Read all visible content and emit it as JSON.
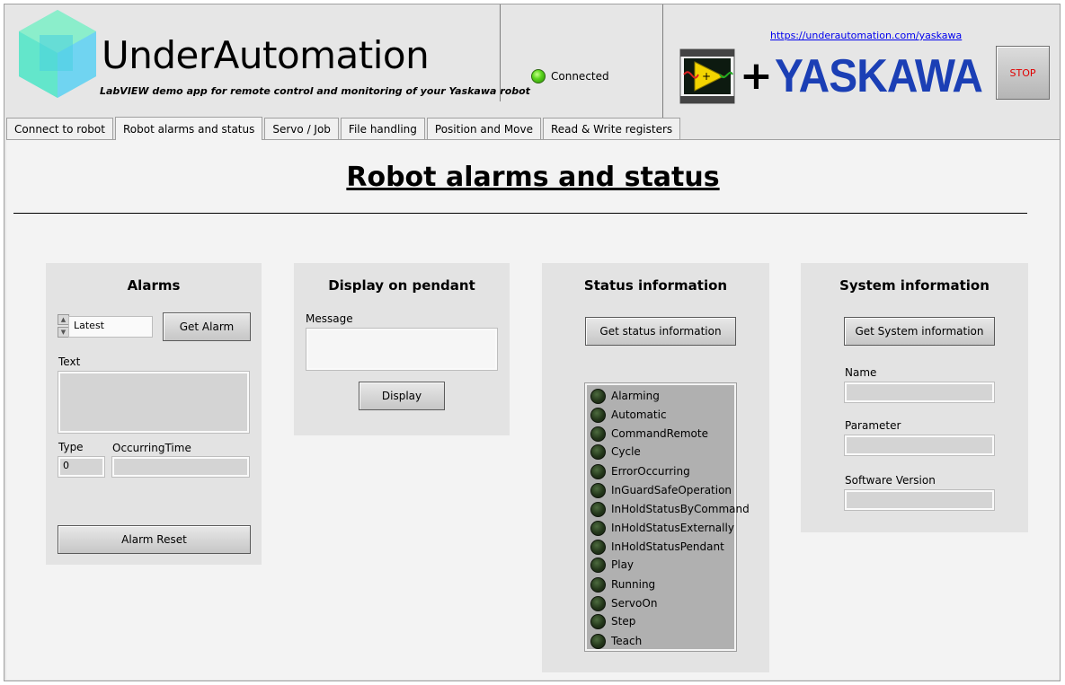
{
  "header": {
    "brand": "UnderAutomation",
    "tagline": "LabVIEW demo app for remote control and monitoring of your Yaskawa robot",
    "connection_status": "Connected",
    "url": "https://underautomation.com/yaskawa",
    "partner_logo_text": "YASKAWA",
    "plus_sign": "+",
    "stop_label": "STOP",
    "colors": {
      "connected_led": "#5cd61e",
      "yaskawa_blue": "#1b3fb5",
      "stop_text": "#e00000"
    }
  },
  "tabs": [
    {
      "label": "Connect to robot",
      "active": false
    },
    {
      "label": "Robot alarms and status",
      "active": true
    },
    {
      "label": "Servo / Job",
      "active": false
    },
    {
      "label": "File handling",
      "active": false
    },
    {
      "label": "Position and Move",
      "active": false
    },
    {
      "label": "Read & Write registers",
      "active": false
    }
  ],
  "page": {
    "title": "Robot alarms and status"
  },
  "alarms": {
    "title": "Alarms",
    "selector_value": "Latest",
    "get_alarm_label": "Get Alarm",
    "text_label": "Text",
    "text_value": "",
    "type_label": "Type",
    "type_value": "0",
    "occurring_time_label": "OccurringTime",
    "occurring_time_value": "",
    "reset_label": "Alarm Reset"
  },
  "pendant": {
    "title": "Display on pendant",
    "message_label": "Message",
    "message_value": "",
    "display_label": "Display"
  },
  "status": {
    "title": "Status information",
    "get_label": "Get status information",
    "indicators": [
      "Alarming",
      "Automatic",
      "CommandRemote",
      "Cycle",
      "ErrorOccurring",
      "InGuardSafeOperation",
      "InHoldStatusByCommand",
      "InHoldStatusExternally",
      "InHoldStatusPendant",
      "Play",
      "Running",
      "ServoOn",
      "Step",
      "Teach"
    ]
  },
  "system": {
    "title": "System information",
    "get_label": "Get System information",
    "name_label": "Name",
    "name_value": "",
    "parameter_label": "Parameter",
    "parameter_value": "",
    "software_version_label": "Software Version",
    "software_version_value": ""
  }
}
